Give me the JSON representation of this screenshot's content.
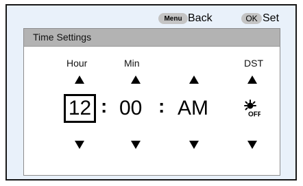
{
  "topbar": {
    "menu_key": "Menu",
    "menu_action": "Back",
    "ok_key": "OK",
    "ok_action": "Set"
  },
  "panel": {
    "title": "Time Settings",
    "columns": {
      "hour_label": "Hour",
      "min_label": "Min",
      "ampm_label": "",
      "dst_label": "DST"
    },
    "values": {
      "hour": "12",
      "separator1": ":",
      "minute": "00",
      "separator2": ":",
      "ampm": "AM",
      "dst_state": "OFF"
    }
  },
  "colors": {
    "screen_bg": "#e9f1fa",
    "header_bg": "#b3b3b3",
    "key_pill": "#c4c4c4"
  },
  "icons": [
    "up-arrow-icon",
    "down-arrow-icon",
    "dst-off-icon"
  ]
}
